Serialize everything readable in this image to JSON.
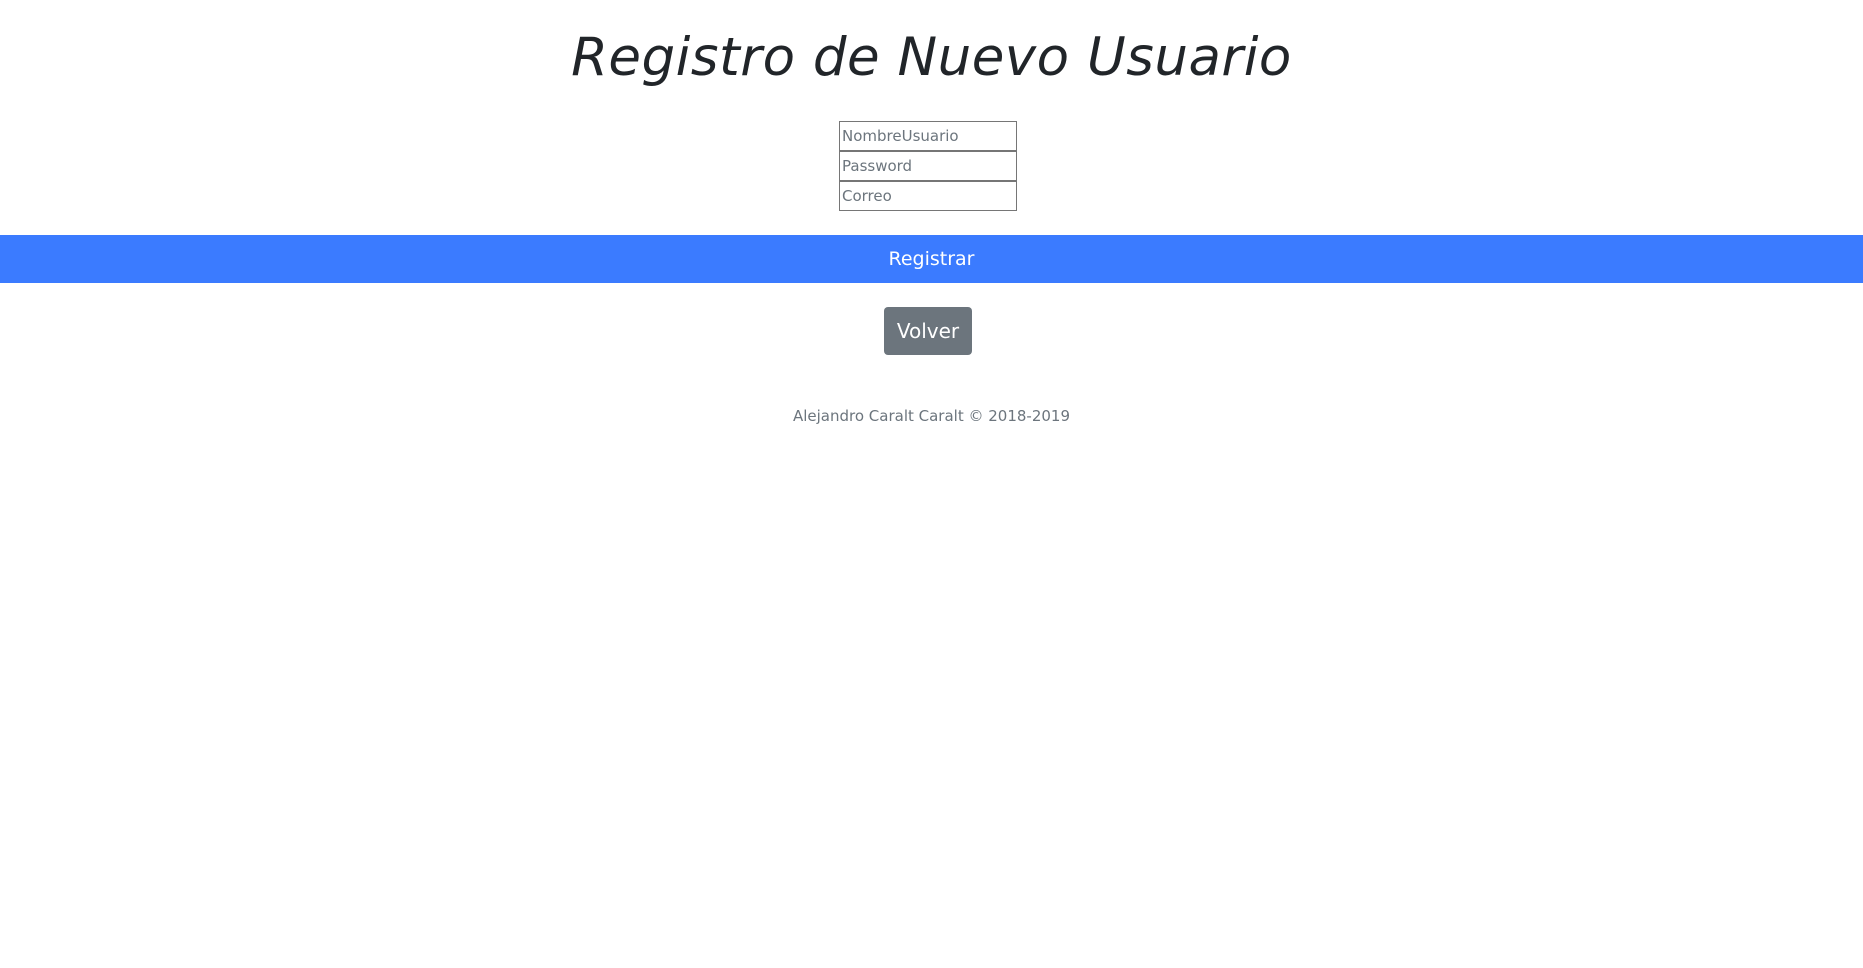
{
  "page": {
    "title": "Registro de Nuevo Usuario"
  },
  "form": {
    "username": {
      "value": "",
      "placeholder": "NombreUsuario"
    },
    "password": {
      "value": "",
      "placeholder": "Password"
    },
    "email": {
      "value": "",
      "placeholder": "Correo"
    }
  },
  "actions": {
    "register_label": "Registrar",
    "back_label": "Volver"
  },
  "footer": {
    "text": "Alejandro Caralt Caralt © 2018-2019"
  },
  "colors": {
    "primary": "#3b7bff",
    "secondary": "#6c757d",
    "text": "#212529"
  }
}
